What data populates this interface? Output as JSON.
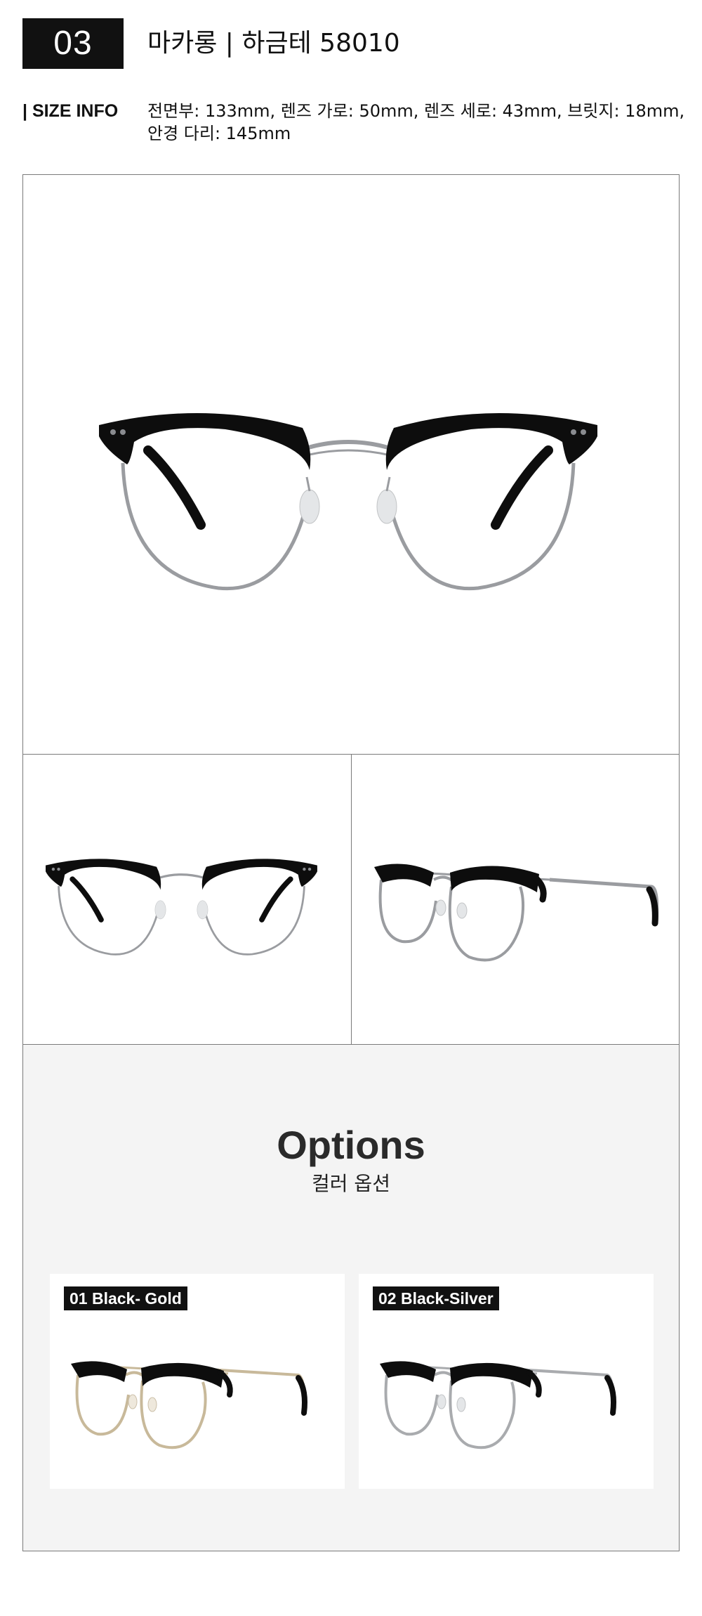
{
  "header": {
    "number": "03",
    "title": "마카롱 | 하금테 58010"
  },
  "size_info": {
    "label": "| SIZE INFO",
    "line1": "전면부: 133mm, 렌즈 가로: 50mm, 렌즈 세로: 43mm, 브릿지: 18mm,",
    "line2": "안경 다리: 145mm"
  },
  "images": {
    "hero": "front-view-glasses",
    "front_small": "front-view-glasses",
    "angle_small": "angled-view-glasses"
  },
  "options": {
    "title": "Options",
    "subtitle": "컬러 옵션",
    "items": [
      {
        "label": "01 Black- Gold",
        "metal_color": "#c8b99a"
      },
      {
        "label": "02 Black-Silver",
        "metal_color": "#a9abae"
      }
    ]
  },
  "colors": {
    "frame_black": "#0d0d0d",
    "metal_silver": "#9a9ca0",
    "panel_bg": "#f4f4f4",
    "border": "#7a7a7a"
  }
}
